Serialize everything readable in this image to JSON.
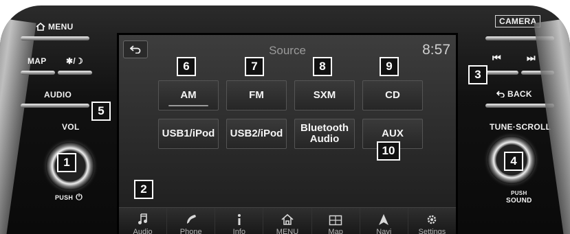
{
  "hardware": {
    "left": {
      "menu_label": "MENU",
      "map_label": "MAP",
      "day_night_label": "✱/☽",
      "audio_label": "AUDIO",
      "vol_label": "VOL",
      "push_label": "PUSH",
      "power_symbol": "⏻"
    },
    "right": {
      "camera_label": "CAMERA",
      "prev_symbol": "⏮",
      "next_symbol": "⏭",
      "back_label": "BACK",
      "tune_scroll_label": "TUNE·SCROLL",
      "push_label": "PUSH",
      "sound_label": "SOUND"
    }
  },
  "callouts": {
    "c1": "1",
    "c2": "2",
    "c3": "3",
    "c4": "4",
    "c5": "5",
    "c6": "6",
    "c7": "7",
    "c8": "8",
    "c9": "9",
    "c10": "10"
  },
  "screen": {
    "title": "Source",
    "clock": "8:57",
    "sources": [
      {
        "label": "AM"
      },
      {
        "label": "FM"
      },
      {
        "label": "SXM"
      },
      {
        "label": "CD"
      },
      {
        "label": "USB1/iPod"
      },
      {
        "label": "USB2/iPod"
      },
      {
        "label": "Bluetooth Audio"
      },
      {
        "label": "AUX"
      }
    ],
    "nav": [
      {
        "label": "Audio",
        "icon": "music-note-icon"
      },
      {
        "label": "Phone",
        "icon": "phone-icon"
      },
      {
        "label": "Info",
        "icon": "info-icon"
      },
      {
        "label": "MENU",
        "icon": "home-icon"
      },
      {
        "label": "Map",
        "icon": "map-icon"
      },
      {
        "label": "Navi",
        "icon": "navigation-arrow-icon"
      },
      {
        "label": "Settings",
        "icon": "gear-icon"
      }
    ]
  },
  "colors": {
    "accent": "#ffffff",
    "screen_bg": "#2a2a2a",
    "callout_bg": "#111111"
  }
}
